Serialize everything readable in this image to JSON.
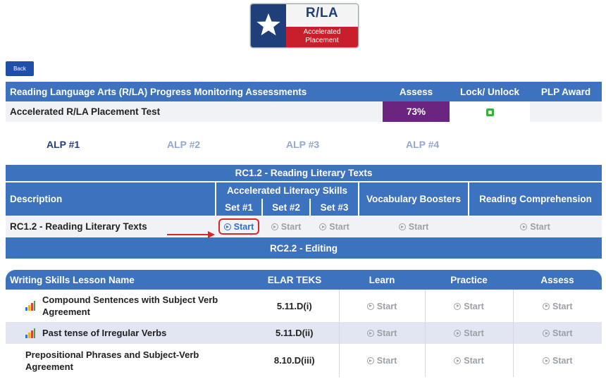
{
  "logo": {
    "title": "R/LA",
    "subtitle_line1": "Accelerated",
    "subtitle_line2": "Placement"
  },
  "back_label": "Back",
  "progress_table": {
    "headers": {
      "name": "Reading Language Arts (R/LA) Progress Monitoring Assessments",
      "assess": "Assess",
      "lock": "Lock/ Unlock",
      "plp": "PLP Award"
    },
    "row": {
      "name": "Accelerated R/LA Placement Test",
      "assess": "73%",
      "lock_icon": "unlock-icon",
      "plp": ""
    }
  },
  "alp_tabs": [
    {
      "label": "ALP #1",
      "active": true
    },
    {
      "label": "ALP #2",
      "active": false
    },
    {
      "label": "ALP #3",
      "active": false
    },
    {
      "label": "ALP #4",
      "active": false
    }
  ],
  "rc1": {
    "title": "RC1.2 - Reading Literary Texts",
    "description_header": "Description",
    "accelerated_header": "Accelerated Literacy Skills",
    "set1": "Set #1",
    "set2": "Set #2",
    "set3": "Set #3",
    "vocab_header": "Vocabulary Boosters",
    "reading_header": "Reading Comprehension",
    "row_label": "RC1.2 - Reading Literary Texts",
    "start_label": "Start"
  },
  "rc2": {
    "title": "RC2.2 - Editing"
  },
  "writing": {
    "headers": {
      "name": "Writing Skills Lesson Name",
      "teks": "ELAR TEKS",
      "learn": "Learn",
      "practice": "Practice",
      "assess": "Assess"
    },
    "rows": [
      {
        "name_line1": "Compound Sentences with Subject Verb",
        "name_line2": "Agreement",
        "teks": "5.11.D(i)",
        "icon": "bar-chart-icon"
      },
      {
        "name_line1": "Past tense of Irregular Verbs",
        "name_line2": "",
        "teks": "5.11.D(ii)",
        "icon": "bar-chart-icon"
      },
      {
        "name_line1": "Prepositional Phrases and Subject-Verb",
        "name_line2": "Agreement",
        "teks": "8.10.D(iii)",
        "icon": ""
      }
    ],
    "start_label": "Start"
  },
  "colors": {
    "header_blue": "#3d72bf",
    "assess_purple": "#6b2480",
    "highlight_red": "#d9262a",
    "active_tab": "#263e80",
    "inactive_tab": "#94a7d2"
  }
}
